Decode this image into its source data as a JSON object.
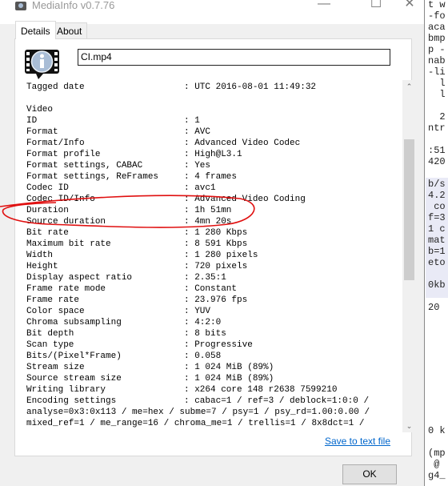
{
  "window": {
    "title": "MediaInfo v0.7.76",
    "minimize": "—",
    "maximize": "☐",
    "close": "✕"
  },
  "tabs": [
    {
      "label": "Details",
      "active": true
    },
    {
      "label": "About",
      "active": false
    }
  ],
  "file": {
    "name": "CI.mp4"
  },
  "details": [
    {
      "label": "Tagged date",
      "value": "UTC 2016-08-01 11:49:32"
    },
    {
      "label": "",
      "value": ""
    },
    {
      "label": "Video",
      "value": null
    },
    {
      "label": "ID",
      "value": "1"
    },
    {
      "label": "Format",
      "value": "AVC"
    },
    {
      "label": "Format/Info",
      "value": "Advanced Video Codec"
    },
    {
      "label": "Format profile",
      "value": "High@L3.1"
    },
    {
      "label": "Format settings, CABAC",
      "value": "Yes"
    },
    {
      "label": "Format settings, ReFrames",
      "value": "4 frames"
    },
    {
      "label": "Codec ID",
      "value": "avc1"
    },
    {
      "label": "Codec ID/Info",
      "value": "Advanced Video Coding"
    },
    {
      "label": "Duration",
      "value": "1h 51mn"
    },
    {
      "label": "Source duration",
      "value": "4mn 20s"
    },
    {
      "label": "Bit rate",
      "value": "1 280 Kbps"
    },
    {
      "label": "Maximum bit rate",
      "value": "8 591 Kbps"
    },
    {
      "label": "Width",
      "value": "1 280 pixels"
    },
    {
      "label": "Height",
      "value": "720 pixels"
    },
    {
      "label": "Display aspect ratio",
      "value": "2.35:1"
    },
    {
      "label": "Frame rate mode",
      "value": "Constant"
    },
    {
      "label": "Frame rate",
      "value": "23.976 fps"
    },
    {
      "label": "Color space",
      "value": "YUV"
    },
    {
      "label": "Chroma subsampling",
      "value": "4:2:0"
    },
    {
      "label": "Bit depth",
      "value": "8 bits"
    },
    {
      "label": "Scan type",
      "value": "Progressive"
    },
    {
      "label": "Bits/(Pixel*Frame)",
      "value": "0.058"
    },
    {
      "label": "Stream size",
      "value": "1 024 MiB (89%)"
    },
    {
      "label": "Source stream size",
      "value": "1 024 MiB (89%)"
    },
    {
      "label": "Writing library",
      "value": "x264 core 148 r2638 7599210"
    },
    {
      "label": "Encoding settings",
      "value": "cabac=1 / ref=3 / deblock=1:0:0 /"
    },
    {
      "label": null,
      "value": "analyse=0x3:0x113 / me=hex / subme=7 / psy=1 / psy_rd=1.00:0.00 /"
    },
    {
      "label": null,
      "value": "mixed_ref=1 / me_range=16 / chroma_me=1 / trellis=1 / 8x8dct=1 /"
    }
  ],
  "separator": ": ",
  "scroll": {
    "up": "⌃",
    "down": "⌄"
  },
  "actions": {
    "save": "Save to text file",
    "ok": "OK"
  },
  "annotation_color": "#e01010",
  "background_terminal": [
    "t w",
    "-fo",
    "aca",
    "bmp",
    "p -",
    "nab",
    "-li",
    "  l",
    "  l",
    "",
    "  2",
    "ntr",
    "",
    ":51",
    "420",
    "",
    "b/s",
    "4.2",
    " co",
    "f=3",
    "1 c",
    "mat",
    "b=1",
    "eto",
    "",
    "0kb",
    "",
    "20",
    "",
    "",
    "",
    "",
    "",
    "",
    "",
    "",
    "",
    "",
    "0 k",
    "",
    "(mp",
    " @",
    "g4_"
  ]
}
